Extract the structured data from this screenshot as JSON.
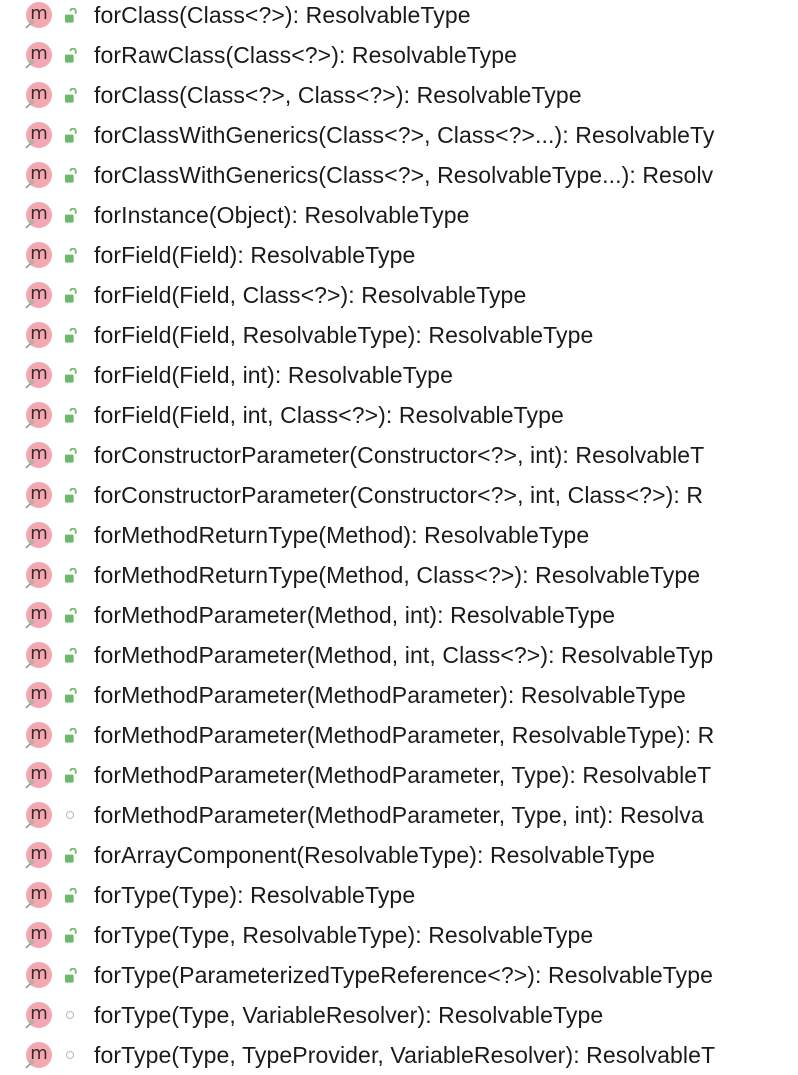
{
  "colors": {
    "method_icon_bg": "#f3a7b1",
    "public_lock": "#6fb96a",
    "package_dot": "#b9b9b9",
    "text": "#1a1a1a"
  },
  "icons": {
    "method": "method-m-icon",
    "public": "green-lock-icon",
    "package_private": "gray-circle-icon",
    "overlay": "pin-icon"
  },
  "members": [
    {
      "signature": "forClass(Class<?>): ResolvableType",
      "visibility": "public"
    },
    {
      "signature": "forRawClass(Class<?>): ResolvableType",
      "visibility": "public"
    },
    {
      "signature": "forClass(Class<?>, Class<?>): ResolvableType",
      "visibility": "public"
    },
    {
      "signature": "forClassWithGenerics(Class<?>, Class<?>...): ResolvableTy",
      "visibility": "public"
    },
    {
      "signature": "forClassWithGenerics(Class<?>, ResolvableType...): Resolv",
      "visibility": "public"
    },
    {
      "signature": "forInstance(Object): ResolvableType",
      "visibility": "public"
    },
    {
      "signature": "forField(Field): ResolvableType",
      "visibility": "public"
    },
    {
      "signature": "forField(Field, Class<?>): ResolvableType",
      "visibility": "public"
    },
    {
      "signature": "forField(Field, ResolvableType): ResolvableType",
      "visibility": "public"
    },
    {
      "signature": "forField(Field, int): ResolvableType",
      "visibility": "public"
    },
    {
      "signature": "forField(Field, int, Class<?>): ResolvableType",
      "visibility": "public"
    },
    {
      "signature": "forConstructorParameter(Constructor<?>, int): ResolvableT",
      "visibility": "public"
    },
    {
      "signature": "forConstructorParameter(Constructor<?>, int, Class<?>): R",
      "visibility": "public"
    },
    {
      "signature": "forMethodReturnType(Method): ResolvableType",
      "visibility": "public"
    },
    {
      "signature": "forMethodReturnType(Method, Class<?>): ResolvableType",
      "visibility": "public"
    },
    {
      "signature": "forMethodParameter(Method, int): ResolvableType",
      "visibility": "public"
    },
    {
      "signature": "forMethodParameter(Method, int, Class<?>): ResolvableTyp",
      "visibility": "public"
    },
    {
      "signature": "forMethodParameter(MethodParameter): ResolvableType",
      "visibility": "public"
    },
    {
      "signature": "forMethodParameter(MethodParameter, ResolvableType): R",
      "visibility": "public"
    },
    {
      "signature": "forMethodParameter(MethodParameter, Type): ResolvableT",
      "visibility": "public"
    },
    {
      "signature": "forMethodParameter(MethodParameter, Type, int): Resolva",
      "visibility": "package"
    },
    {
      "signature": "forArrayComponent(ResolvableType): ResolvableType",
      "visibility": "public"
    },
    {
      "signature": "forType(Type): ResolvableType",
      "visibility": "public"
    },
    {
      "signature": "forType(Type, ResolvableType): ResolvableType",
      "visibility": "public"
    },
    {
      "signature": "forType(ParameterizedTypeReference<?>): ResolvableType",
      "visibility": "public"
    },
    {
      "signature": "forType(Type, VariableResolver): ResolvableType",
      "visibility": "package"
    },
    {
      "signature": "forType(Type, TypeProvider, VariableResolver): ResolvableT",
      "visibility": "package"
    }
  ]
}
